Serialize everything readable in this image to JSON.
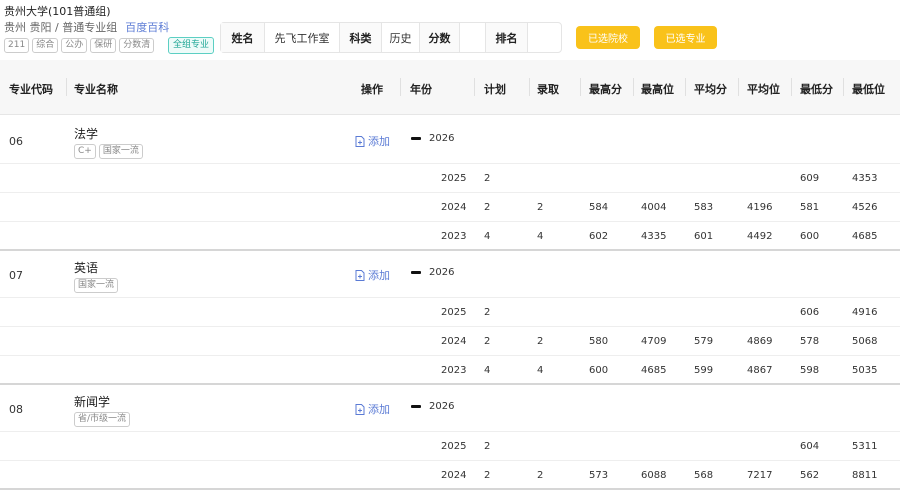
{
  "header": {
    "title": "贵州大学(101普通组)",
    "location": "贵州 贵阳 / 普通专业组",
    "baike": "百度百科",
    "tags": [
      "211",
      "综合",
      "公办",
      "保研",
      "分数清"
    ],
    "all_group": "全组专业"
  },
  "info": {
    "name_label": "姓名",
    "name_value": "先飞工作室",
    "subject_label": "科类",
    "subject_value": "历史",
    "score_label": "分数",
    "score_value": "",
    "rank_label": "排名",
    "rank_value": ""
  },
  "buttons": {
    "selected_colleges": "已选院校",
    "selected_majors": "已选专业"
  },
  "columns": [
    "专业代码",
    "专业名称",
    "操作",
    "年份",
    "计划",
    "录取",
    "最高分",
    "最高位",
    "平均分",
    "平均位",
    "最低分",
    "最低位"
  ],
  "add_label": "添加",
  "majors": [
    {
      "code": "06",
      "name": "法学",
      "tags": [
        "C+",
        "国家一流"
      ],
      "current_year": "2026",
      "rows": [
        {
          "year": "2025",
          "plan": "2",
          "admit": "",
          "max": "",
          "max_rank": "",
          "avg": "",
          "avg_rank": "",
          "min": "609",
          "min_rank": "4353"
        },
        {
          "year": "2024",
          "plan": "2",
          "admit": "2",
          "max": "584",
          "max_rank": "4004",
          "avg": "583",
          "avg_rank": "4196",
          "min": "581",
          "min_rank": "4526"
        },
        {
          "year": "2023",
          "plan": "4",
          "admit": "4",
          "max": "602",
          "max_rank": "4335",
          "avg": "601",
          "avg_rank": "4492",
          "min": "600",
          "min_rank": "4685"
        }
      ]
    },
    {
      "code": "07",
      "name": "英语",
      "tags": [
        "国家一流"
      ],
      "current_year": "2026",
      "rows": [
        {
          "year": "2025",
          "plan": "2",
          "admit": "",
          "max": "",
          "max_rank": "",
          "avg": "",
          "avg_rank": "",
          "min": "606",
          "min_rank": "4916"
        },
        {
          "year": "2024",
          "plan": "2",
          "admit": "2",
          "max": "580",
          "max_rank": "4709",
          "avg": "579",
          "avg_rank": "4869",
          "min": "578",
          "min_rank": "5068"
        },
        {
          "year": "2023",
          "plan": "4",
          "admit": "4",
          "max": "600",
          "max_rank": "4685",
          "avg": "599",
          "avg_rank": "4867",
          "min": "598",
          "min_rank": "5035"
        }
      ]
    },
    {
      "code": "08",
      "name": "新闻学",
      "tags": [
        "省/市级一流"
      ],
      "current_year": "2026",
      "rows": [
        {
          "year": "2025",
          "plan": "2",
          "admit": "",
          "max": "",
          "max_rank": "",
          "avg": "",
          "avg_rank": "",
          "min": "604",
          "min_rank": "5311"
        },
        {
          "year": "2024",
          "plan": "2",
          "admit": "2",
          "max": "573",
          "max_rank": "6088",
          "avg": "568",
          "avg_rank": "7217",
          "min": "562",
          "min_rank": "8811"
        }
      ]
    }
  ]
}
